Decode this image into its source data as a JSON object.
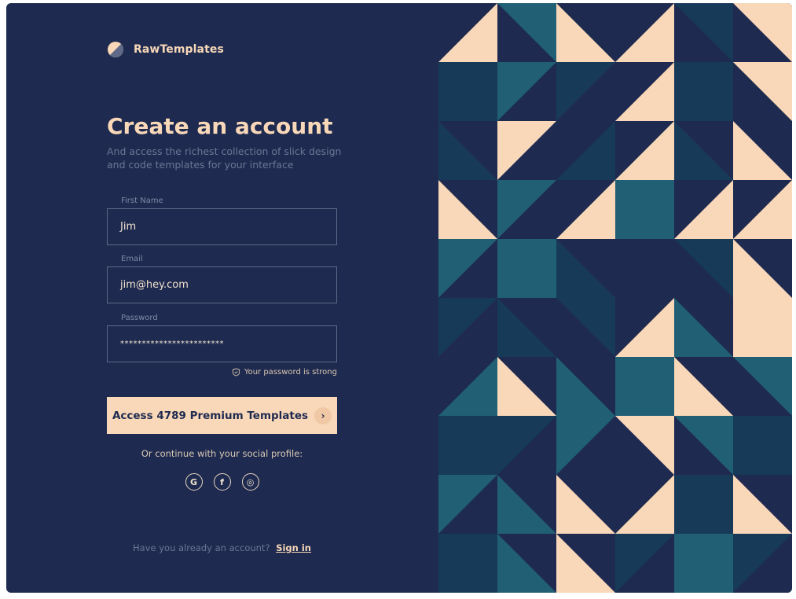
{
  "brand": {
    "name": "RawTemplates",
    "icon": "logo-icon"
  },
  "heading": {
    "title": "Create an account",
    "subtitle": "And access the richest collection of slick design and code templates for your interface"
  },
  "form": {
    "first_name": {
      "label": "First Name",
      "value": "Jim"
    },
    "email": {
      "label": "Email",
      "value": "jim@hey.com"
    },
    "password": {
      "label": "Password",
      "value": "************************"
    },
    "strength_text": "Your password is strong"
  },
  "cta": {
    "label": "Access 4789 Premium Templates",
    "icon": "chevron-right-icon"
  },
  "social": {
    "prompt": "Or continue with your social profile:",
    "buttons": [
      {
        "name": "google",
        "glyph": "G"
      },
      {
        "name": "facebook",
        "glyph": "f"
      },
      {
        "name": "dribbble",
        "glyph": "◎"
      }
    ]
  },
  "footer": {
    "question": "Have you already an account?",
    "link": "Sign in"
  },
  "colors": {
    "background": "#1e2a4f",
    "accent": "#f9d8b9",
    "teal": "#205f74",
    "navy_mid": "#173a59"
  }
}
